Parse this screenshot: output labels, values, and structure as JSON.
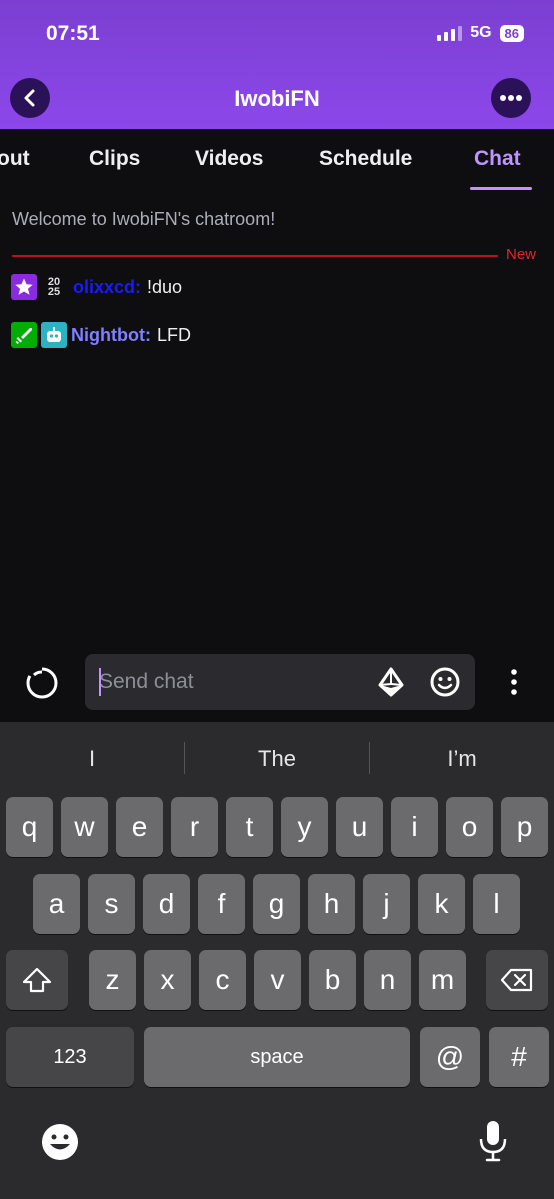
{
  "status": {
    "time": "07:51",
    "network": "5G",
    "battery": "86"
  },
  "header": {
    "title": "IwobiFN"
  },
  "tabs": [
    {
      "label": "out",
      "left": 0
    },
    {
      "label": "Clips"
    },
    {
      "label": "Videos"
    },
    {
      "label": "Schedule"
    },
    {
      "label": "Chat",
      "active": true
    }
  ],
  "chat": {
    "welcome": "Welcome to IwobiFN's chatroom!",
    "new_label": "New",
    "messages": [
      {
        "user": "olixxcd:",
        "text": "!duo",
        "badge_year_top": "20",
        "badge_year_bottom": "25"
      },
      {
        "user": "Nightbot:",
        "text": "LFD"
      }
    ]
  },
  "input": {
    "placeholder": "Send chat"
  },
  "keyboard": {
    "suggestions": [
      "I",
      "The",
      "I’m"
    ],
    "row1": [
      "q",
      "w",
      "e",
      "r",
      "t",
      "y",
      "u",
      "i",
      "o",
      "p"
    ],
    "row2": [
      "a",
      "s",
      "d",
      "f",
      "g",
      "h",
      "j",
      "k",
      "l"
    ],
    "row3": [
      "z",
      "x",
      "c",
      "v",
      "b",
      "n",
      "m"
    ],
    "numbers_key": "123",
    "space_key": "space",
    "at_key": "@",
    "hash_key": "#"
  },
  "colors": {
    "header": "#8c47ea",
    "accent": "#bf94ff",
    "new_divider": "#b5141e",
    "olixxcd_name": "#1a1aff",
    "nightbot_name": "#7f7fff"
  }
}
